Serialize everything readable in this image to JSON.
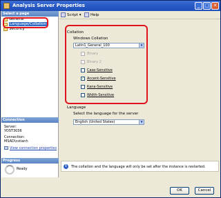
{
  "window": {
    "title": "Analysis Server Properties"
  },
  "left": {
    "select_page_header": "Select a page",
    "pages": [
      {
        "label": "General"
      },
      {
        "label": "Language/Collation"
      },
      {
        "label": "Security"
      }
    ],
    "connection_header": "Connection",
    "server_label": "Server:",
    "server_value": "YOST3036",
    "connection_label": "Connection:",
    "connection_value": "MSAD\\cstianh",
    "view_link": "View connection properties",
    "progress_header": "Progress",
    "progress_status": "Ready"
  },
  "toolbar": {
    "script_label": "Script",
    "help_label": "Help"
  },
  "collation": {
    "group_label": "Collation",
    "windows_collation_label": "Windows Collation",
    "windows_collation_value": "Latin1_General_100",
    "options": [
      {
        "label": "Binary",
        "checked": false,
        "enabled": false
      },
      {
        "label": "Binary 2",
        "checked": false,
        "enabled": false
      },
      {
        "label": "Case-Sensitive",
        "checked": false,
        "enabled": true
      },
      {
        "label": "Accent-Sensitive",
        "checked": true,
        "enabled": true
      },
      {
        "label": "Kana-Sensitive",
        "checked": false,
        "enabled": true
      },
      {
        "label": "Width-Sensitive",
        "checked": false,
        "enabled": true
      }
    ]
  },
  "language": {
    "group_label": "Language",
    "select_label": "Select the language for the server",
    "value": "English (United States)"
  },
  "info": {
    "message": "The collation and the language will only be set after the instance is restarted."
  },
  "buttons": {
    "ok": "OK",
    "cancel": "Cancel"
  },
  "colors": {
    "highlight": "#e0121b",
    "title_bar": "#2a5bc7",
    "selected": "#316ac5"
  }
}
